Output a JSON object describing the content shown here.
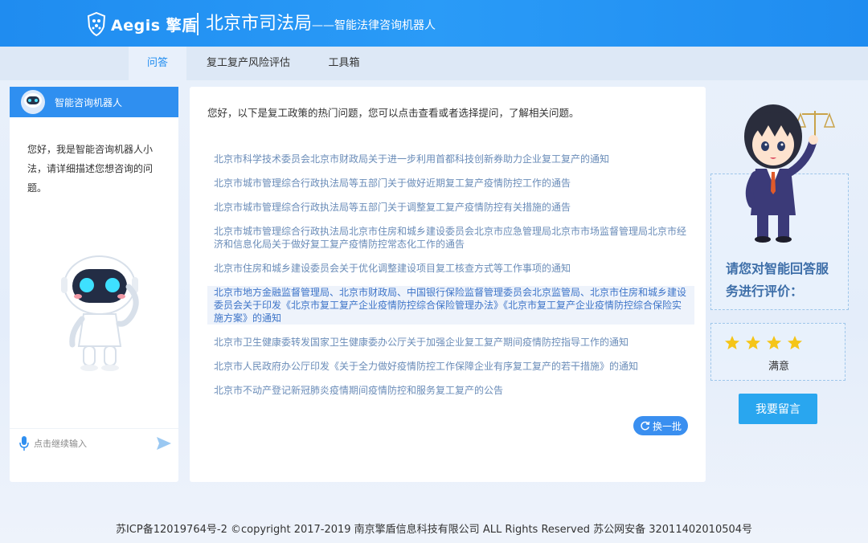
{
  "header": {
    "brand": "Aegis 擎盾",
    "org": "北京市司法局",
    "subtitle": "——智能法律咨询机器人"
  },
  "tabs": [
    {
      "label": "问答",
      "active": true
    },
    {
      "label": "复工复产风险评估",
      "active": false
    },
    {
      "label": "工具箱",
      "active": false
    }
  ],
  "chatbot": {
    "name": "智能咨询机器人",
    "greeting": "您好，我是智能咨询机器人小法，请详细描述您想咨询的问题。",
    "input_placeholder": "点击继续输入"
  },
  "faq": {
    "intro": "您好，以下是复工政策的热门问题，您可以点击查看或者选择提问，了解相关问题。",
    "questions": [
      "北京市科学技术委员会北京市财政局关于进一步利用首都科技创新券助力企业复工复产的通知",
      "北京市城市管理综合行政执法局等五部门关于做好近期复工复产疫情防控工作的通告",
      "北京市城市管理综合行政执法局等五部门关于调整复工复产疫情防控有关措施的通告",
      "北京市城市管理综合行政执法局北京市住房和城乡建设委员会北京市应急管理局北京市市场监督管理局北京市经济和信息化局关于做好复工复产疫情防控常态化工作的通告",
      "北京市住房和城乡建设委员会关于优化调整建设项目复工核查方式等工作事项的通知",
      "北京市地方金融监督管理局、北京市财政局、中国银行保险监督管理委员会北京监管局、北京市住房和城乡建设委员会关于印发《北京市复工复产企业疫情防控综合保险管理办法》《北京市复工复产企业疫情防控综合保险实施方案》的通知",
      "北京市卫生健康委转发国家卫生健康委办公厅关于加强企业复工复产期间疫情防控指导工作的通知",
      "北京市人民政府办公厅印发《关于全力做好疫情防控工作保障企业有序复工复产的若干措施》的通知",
      "北京市不动产登记新冠肺炎疫情期间疫情防控和服务复工复产的公告"
    ],
    "highlighted_index": 5,
    "refresh_label": "换一批"
  },
  "rating": {
    "prompt": "请您对智能回答服务进行评价：",
    "stars": 4,
    "label": "满意",
    "message_button": "我要留言"
  },
  "footer": {
    "text": "苏ICP备12019764号-2 ©copyright 2017-2019 南京擎盾信息科技有限公司 ALL Rights Reserved 苏公网安备 32011402010504号"
  },
  "colors": {
    "primary": "#1f8cf0",
    "link": "#6a8cb8",
    "star": "#f5c518"
  }
}
